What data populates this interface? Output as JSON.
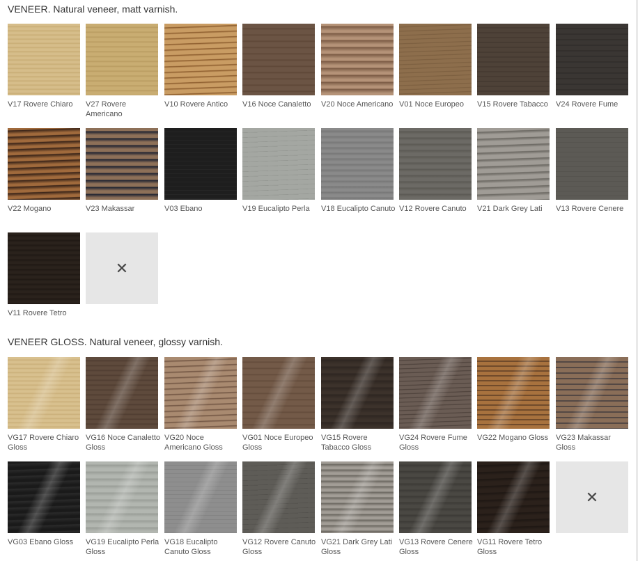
{
  "sections": [
    {
      "title": "VENEER. Natural veneer, matt varnish.",
      "items": [
        {
          "label": "V17 Rovere Chiaro",
          "color": "#d6bd8a",
          "grain": "#c8ab74"
        },
        {
          "label": "V27 Rovere Americano",
          "color": "#c9ad72",
          "grain": "#b89a5f"
        },
        {
          "label": "V10 Rovere Antico",
          "color": "#c99c63",
          "grain": "#8a5a2b"
        },
        {
          "label": "V16 Noce Canaletto",
          "color": "#6b5444",
          "grain": "#5c4636"
        },
        {
          "label": "V20 Noce Americano",
          "color": "#b59378",
          "grain": "#7a5a44"
        },
        {
          "label": "V01 Noce Europeo",
          "color": "#8d6e4c",
          "grain": "#7a5d3e"
        },
        {
          "label": "V15 Rovere Tabacco",
          "color": "#4e4238",
          "grain": "#3f342c"
        },
        {
          "label": "V24 Rovere Fume",
          "color": "#3a3633",
          "grain": "#2b2826"
        },
        {
          "label": "V22 Mogano",
          "color": "#a06a3c",
          "grain": "#3a2418"
        },
        {
          "label": "V23 Makassar",
          "color": "#8d7058",
          "grain": "#1e2230"
        },
        {
          "label": "V03 Ebano",
          "color": "#1e1e1e",
          "grain": "#2c2c2c"
        },
        {
          "label": "V19 Eucalipto Perla",
          "color": "#a4a7a2",
          "grain": "#8e918c"
        },
        {
          "label": "V18 Eucalipto Canuto",
          "color": "#8a8a8a",
          "grain": "#777777"
        },
        {
          "label": "V12 Rovere Canuto",
          "color": "#6c6a65",
          "grain": "#5b5954"
        },
        {
          "label": "V21 Dark Grey Lati",
          "color": "#a09c96",
          "grain": "#6b6862"
        },
        {
          "label": "V13 Rovere Cenere",
          "color": "#5c5a55",
          "grain": "#4e4c48"
        },
        {
          "label": "V11 Rovere Tetro",
          "color": "#2a221c",
          "grain": "#1f1914"
        },
        {
          "label": "",
          "empty": true,
          "icon": "close-icon"
        }
      ]
    },
    {
      "title": "VENEER GLOSS. Natural veneer, glossy varnish.",
      "items": [
        {
          "label": "VG17 Rovere Chiaro Gloss",
          "color": "#d8c08e",
          "grain": "#c9ad78"
        },
        {
          "label": "VG16 Noce Canaletto Gloss",
          "color": "#5e4a3c",
          "grain": "#4e3c30"
        },
        {
          "label": "VG20 Noce Americano Gloss",
          "color": "#a98a70",
          "grain": "#6e5240"
        },
        {
          "label": "VG01 Noce Europeo Gloss",
          "color": "#735a48",
          "grain": "#614a3a"
        },
        {
          "label": "VG15 Rovere Tabacco Gloss",
          "color": "#3c322b",
          "grain": "#2e2621"
        },
        {
          "label": "VG24 Rovere Fume Gloss",
          "color": "#6a5c54",
          "grain": "#4a3e38"
        },
        {
          "label": "VG22 Mogano Gloss",
          "color": "#a8723e",
          "grain": "#3a2418"
        },
        {
          "label": "VG23 Makassar Gloss",
          "color": "#8a6e58",
          "grain": "#1e2230"
        },
        {
          "label": "VG03 Ebano Gloss",
          "color": "#1a1a1a",
          "grain": "#2a2a2a"
        },
        {
          "label": "VG19 Eucalipto Perla Gloss",
          "color": "#b2b6b0",
          "grain": "#9a9e98"
        },
        {
          "label": "VG18 Eucalipto Canuto Gloss",
          "color": "#8e8e8e",
          "grain": "#7a7a7a"
        },
        {
          "label": "VG12 Rovere Canuto Gloss",
          "color": "#5e5c57",
          "grain": "#4e4c48"
        },
        {
          "label": "VG21 Dark Grey Lati Gloss",
          "color": "#a29d96",
          "grain": "#6a665f"
        },
        {
          "label": "VG13 Rovere Cenere Gloss",
          "color": "#4a4843",
          "grain": "#3c3a36"
        },
        {
          "label": "VG11 Rovere Tetro Gloss",
          "color": "#2b211b",
          "grain": "#1e1713"
        },
        {
          "label": "",
          "empty": true,
          "icon": "close-icon"
        }
      ]
    }
  ]
}
